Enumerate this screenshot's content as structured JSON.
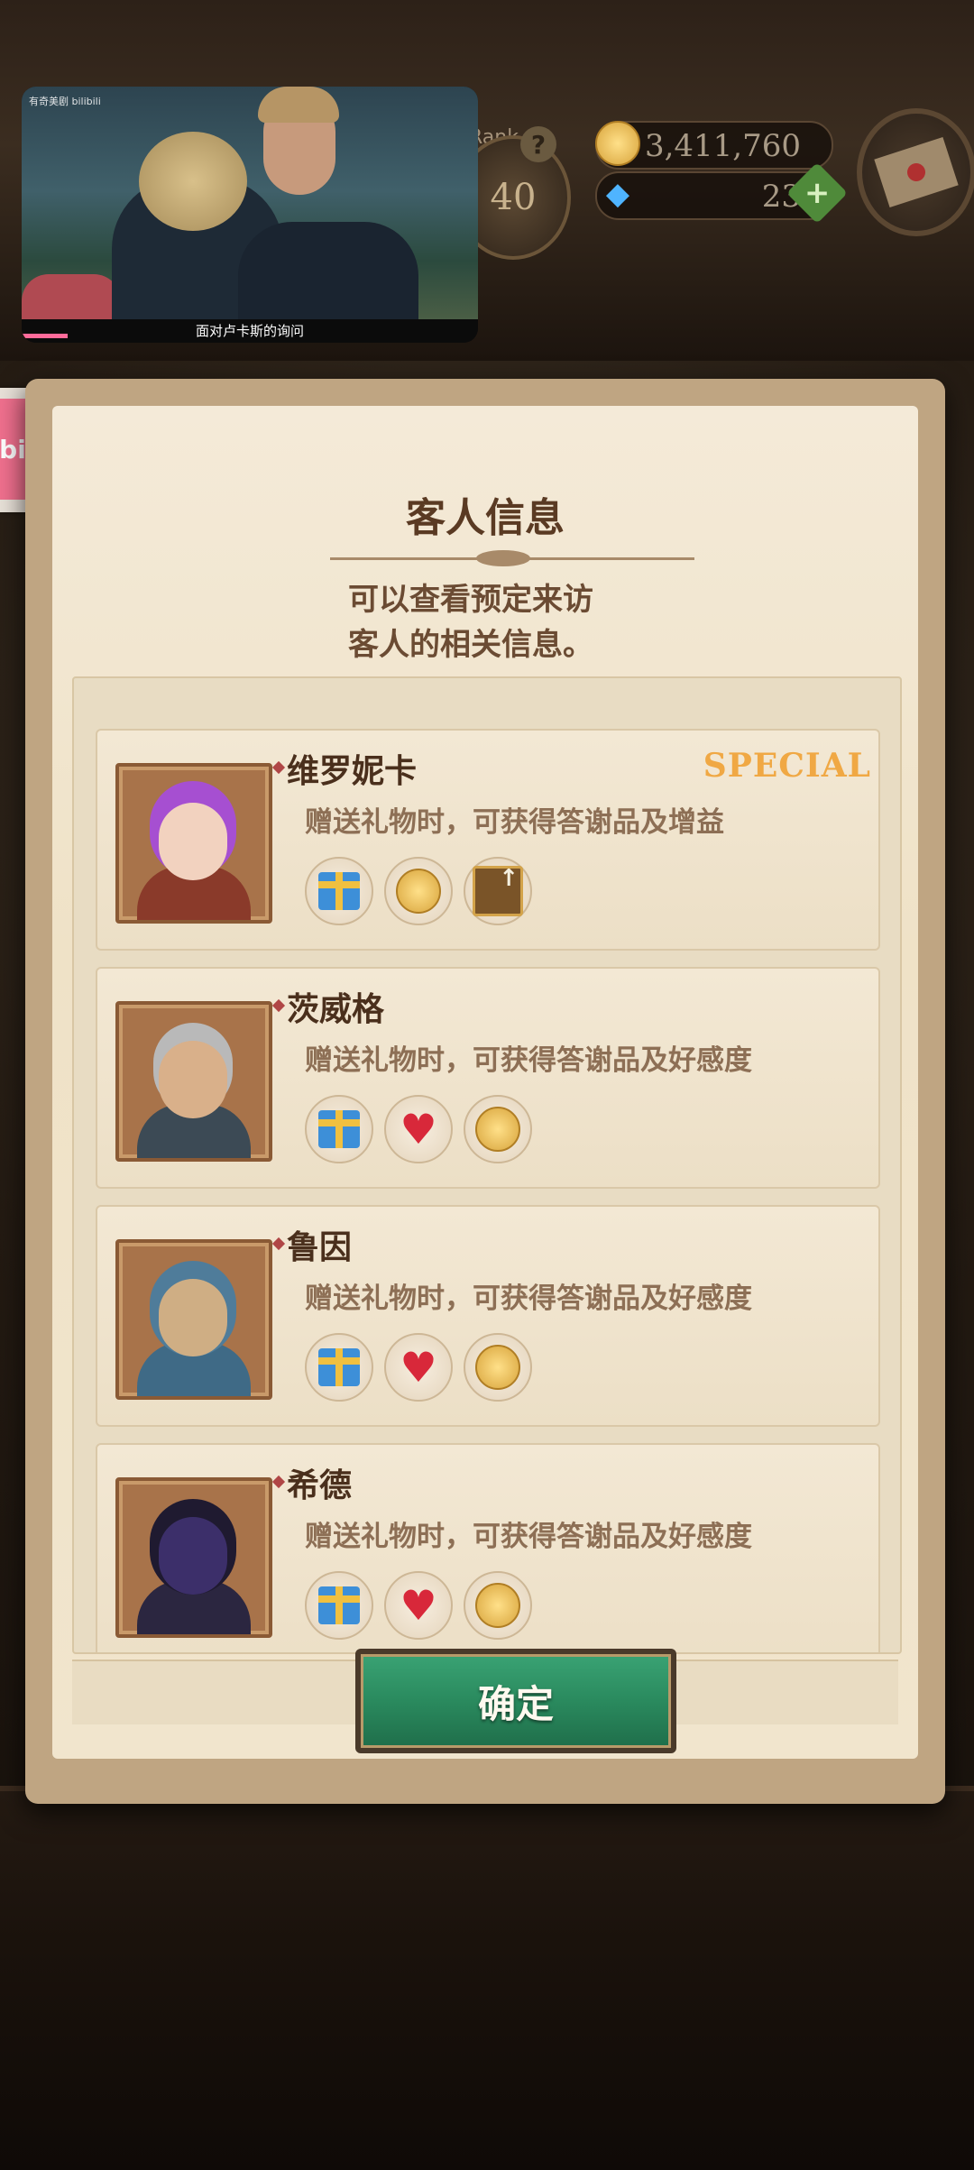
{
  "topbar": {
    "rank_label": "Rank",
    "rank_value": "40",
    "help": "?",
    "gold": "3,411,760",
    "gems": "23",
    "plus": "+"
  },
  "video": {
    "logo_text": "有奇美剧 bilibili",
    "caption": "面对卢卡斯的询问",
    "progress_percent": 10
  },
  "bili_side": {
    "label": "bili"
  },
  "dialog": {
    "title": "客人信息",
    "subtitle_line1": "可以查看预定来访",
    "subtitle_line2": "客人的相关信息。",
    "confirm_label": "确定"
  },
  "guests": [
    {
      "name": "维罗妮卡",
      "desc": "赠送礼物时，可获得答谢品及增益",
      "badge": "SPECIAL",
      "rewards": [
        "gift-icon",
        "coin-icon",
        "boost-icon"
      ]
    },
    {
      "name": "茨威格",
      "desc": "赠送礼物时，可获得答谢品及好感度",
      "badge": "",
      "rewards": [
        "gift-icon",
        "heart-icon",
        "coin-icon"
      ]
    },
    {
      "name": "鲁因",
      "desc": "赠送礼物时，可获得答谢品及好感度",
      "badge": "",
      "rewards": [
        "gift-icon",
        "heart-icon",
        "coin-icon"
      ]
    },
    {
      "name": "希德",
      "desc": "赠送礼物时，可获得答谢品及好感度",
      "badge": "",
      "rewards": [
        "gift-icon",
        "heart-icon",
        "coin-icon"
      ]
    }
  ],
  "colors": {
    "accent_special": "#f0a844",
    "button_green": "#2a8a5e",
    "paper": "#f1e5cd"
  }
}
